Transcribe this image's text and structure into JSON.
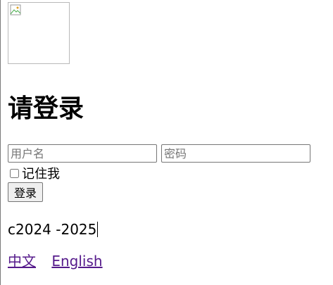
{
  "logo": {
    "icon": "broken-image-icon"
  },
  "heading": "请登录",
  "form": {
    "username_placeholder": "用户名",
    "password_placeholder": "密码",
    "remember_label": "记住我",
    "remember_checked": false,
    "submit_label": "登录"
  },
  "footer": {
    "copyright": "c2024 -2025"
  },
  "languages": [
    {
      "label": "中文"
    },
    {
      "label": "English"
    }
  ],
  "colors": {
    "link_visited": "#551a8b",
    "input_border": "#767676",
    "button_bg": "#efefef"
  }
}
